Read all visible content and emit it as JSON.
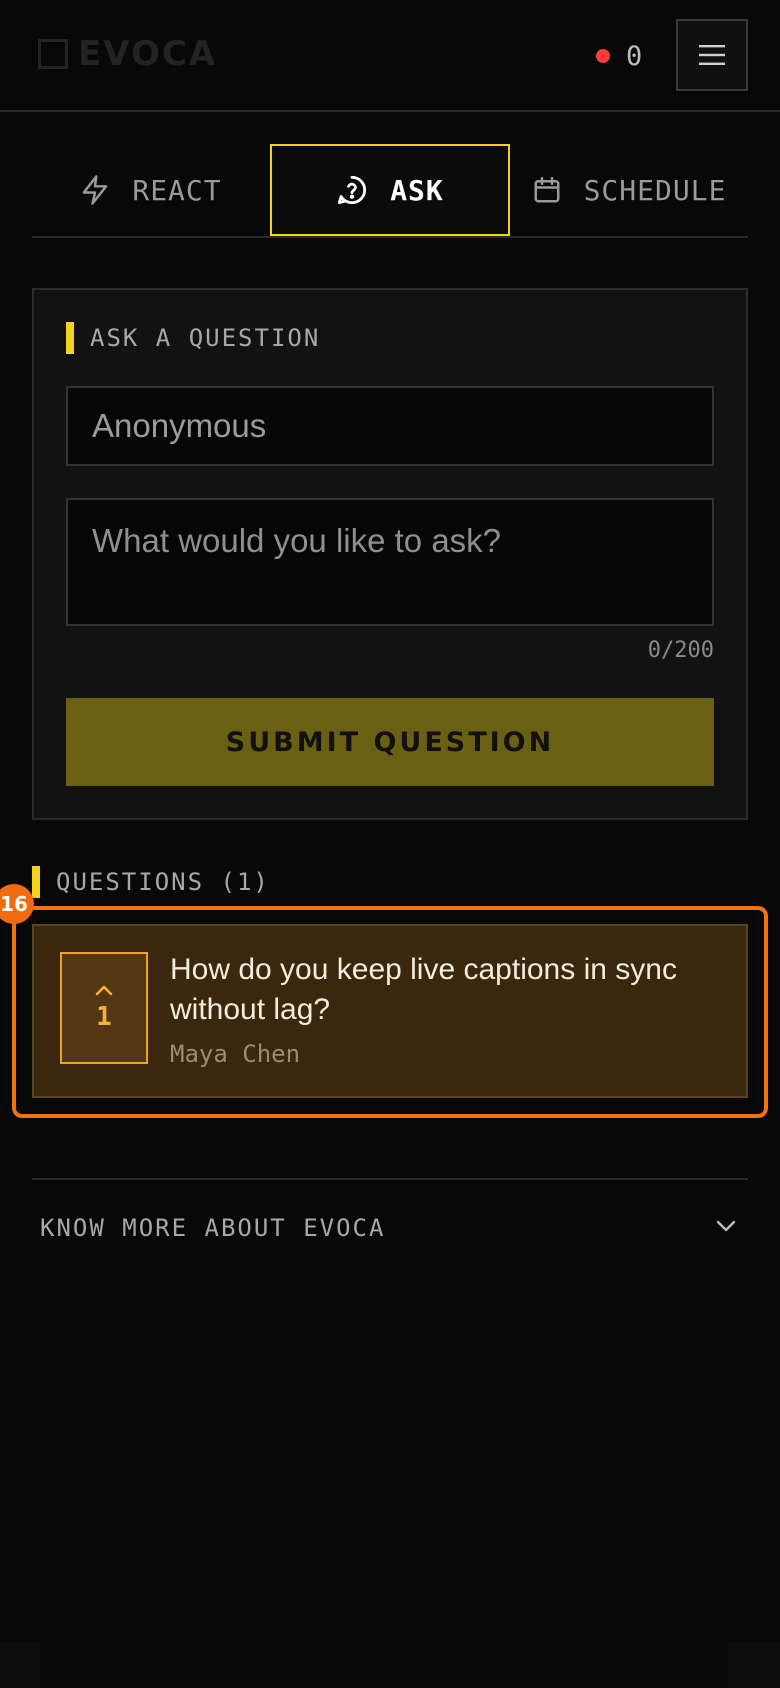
{
  "header": {
    "logo_text": "EVOCA",
    "live_count": "0",
    "menu_icon": "hamburger-icon"
  },
  "tabs": [
    {
      "label": "REACT",
      "icon": "lightning-icon",
      "active": false
    },
    {
      "label": "ASK",
      "icon": "question-circle-icon",
      "active": true
    },
    {
      "label": "SCHEDULE",
      "icon": "calendar-icon",
      "active": false
    }
  ],
  "ask": {
    "section_title": "ASK A QUESTION",
    "name_placeholder": "Anonymous",
    "question_placeholder": "What would you like to ask?",
    "char_count": "0/200",
    "submit_label": "SUBMIT QUESTION"
  },
  "questions": {
    "section_title": "QUESTIONS (1)",
    "badge": "16",
    "items": [
      {
        "text": "How do you keep live captions in sync without lag?",
        "author": "Maya Chen",
        "votes": "1"
      }
    ]
  },
  "footer": {
    "know_more_label": "KNOW MORE ABOUT EVOCA"
  },
  "colors": {
    "accent": "#f2d21b",
    "live_dot": "#ff3b3b",
    "highlight": "#f07312",
    "vote": "#f5b234",
    "submit_bg": "#6a6013"
  }
}
